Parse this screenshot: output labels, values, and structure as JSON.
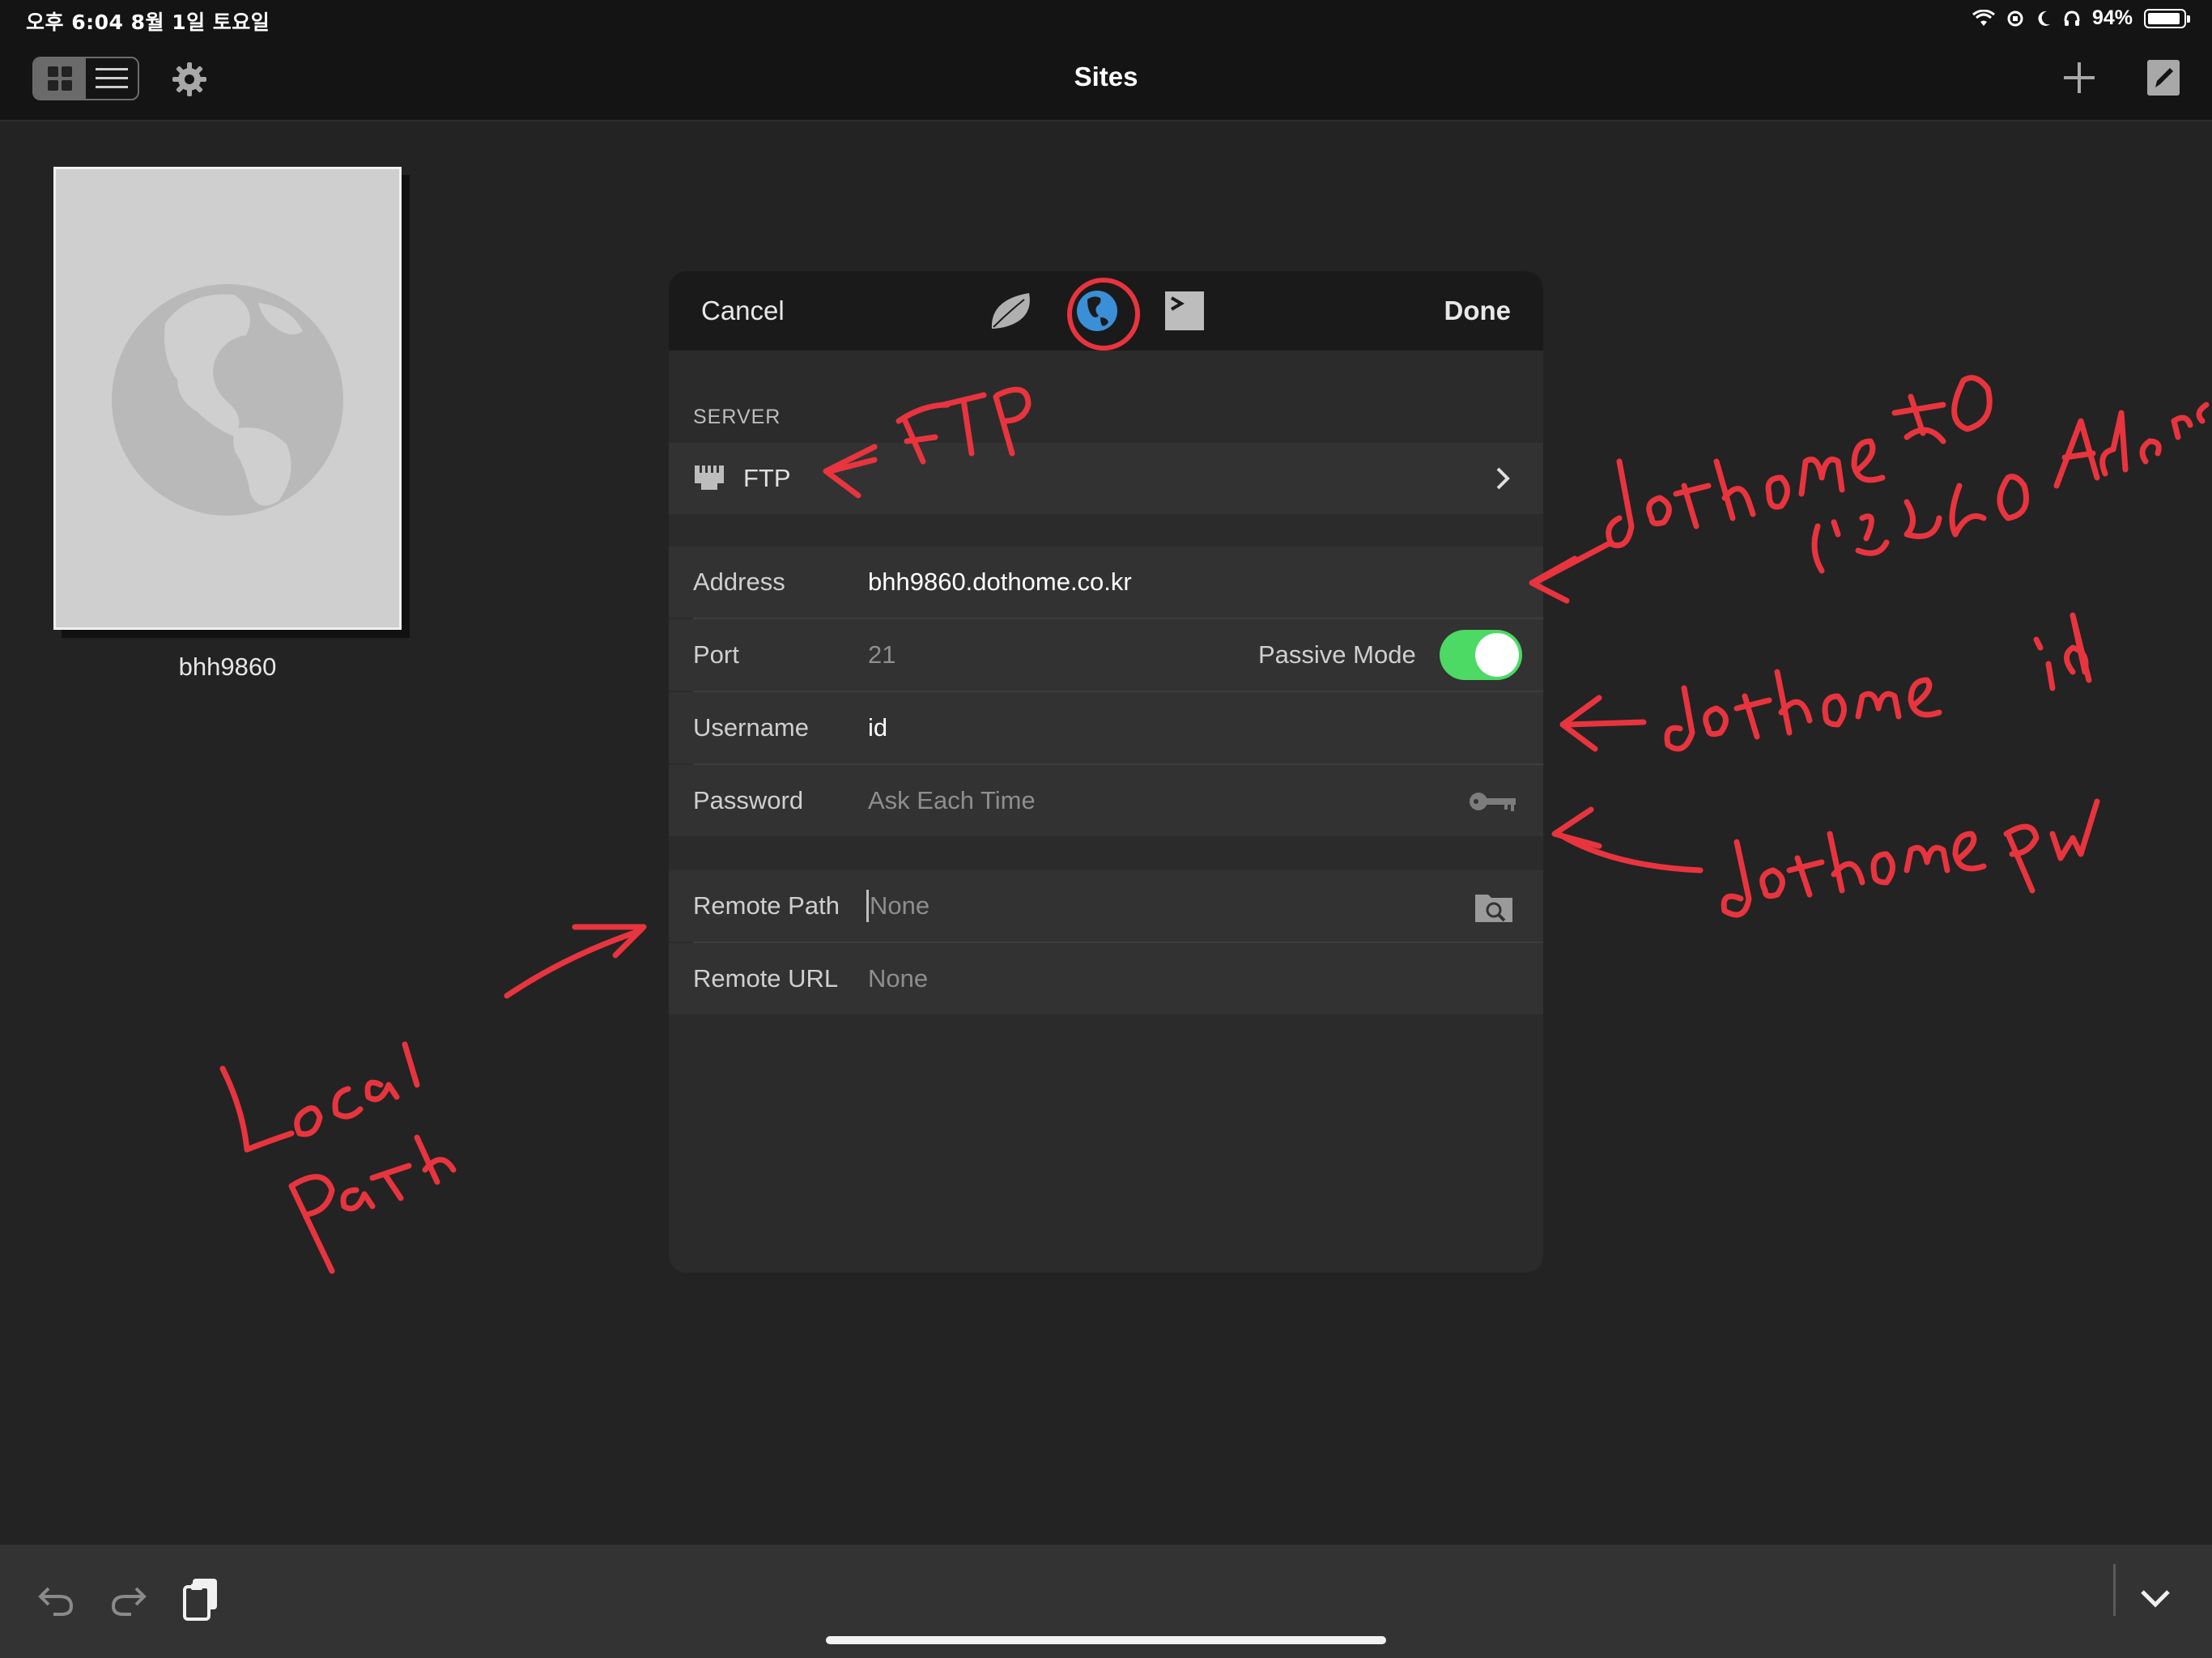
{
  "status_bar": {
    "time_date": "오후 6:04   8월 1일 토요일",
    "battery": "94%"
  },
  "nav": {
    "title": "Sites"
  },
  "site": {
    "name": "bhh9860"
  },
  "dialog": {
    "cancel": "Cancel",
    "done": "Done",
    "server_section": "SERVER",
    "server_type": "FTP",
    "address_label": "Address",
    "address_value": "bhh9860.dothome.co.kr",
    "port_label": "Port",
    "port_value": "21",
    "passive_label": "Passive Mode",
    "passive_on": true,
    "username_label": "Username",
    "username_value": "id",
    "password_label": "Password",
    "password_value": "Ask Each Time",
    "remote_path_label": "Remote Path",
    "remote_path_placeholder": "None",
    "remote_url_label": "Remote URL",
    "remote_url_value": "None"
  },
  "colors": {
    "accent_toggle": "#4cd964",
    "annotation": "#e8343e",
    "globe_blue": "#3a8fd6"
  }
}
